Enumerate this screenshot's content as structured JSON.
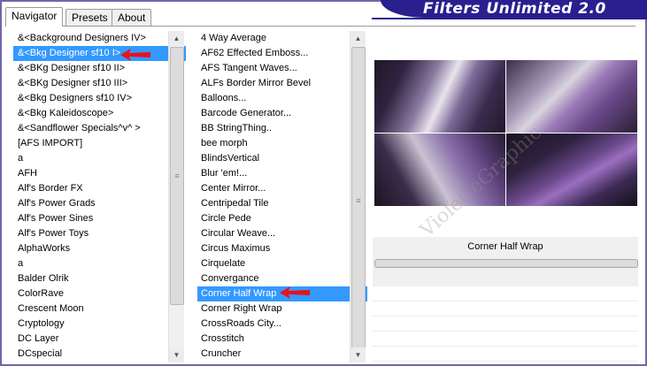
{
  "window": {
    "banner_title": "Filters Unlimited 2.0",
    "accent_color": "#2a1f8f",
    "frame_color": "#7565a8"
  },
  "tabs": [
    {
      "label": "Navigator",
      "active": true
    },
    {
      "label": "Presets",
      "active": false
    },
    {
      "label": "About",
      "active": false
    }
  ],
  "categories": {
    "items": [
      "&<Background Designers IV>",
      "&<Bkg Designer sf10 I>",
      "&<BKg Designer sf10 II>",
      "&<BKg Designer sf10 III>",
      "&<Bkg Designers sf10 IV>",
      "&<Bkg Kaleidoscope>",
      "&<Sandflower Specials^v^ >",
      "[AFS IMPORT]",
      "a",
      "AFH",
      "Alf's Border FX",
      "Alf's Power Grads",
      "Alf's Power Sines",
      "Alf's Power Toys",
      "AlphaWorks",
      "a",
      "Balder Olrik",
      "ColorRave",
      "Crescent Moon",
      "Cryptology",
      "DC Layer",
      "DCspecial"
    ],
    "selected_index": 1
  },
  "filters": {
    "items": [
      "4 Way Average",
      "AF62 Effected Emboss...",
      "AFS Tangent Waves...",
      "ALFs Border Mirror Bevel",
      "Balloons...",
      "Barcode Generator...",
      "BB StringThing..",
      "bee morph",
      "BlindsVertical",
      "Blur 'em!...",
      "Center Mirror...",
      "Centripedal Tile",
      "Circle Pede",
      "Circular Weave...",
      "Circus Maximus",
      "Cirquelate",
      "Convergance",
      "Corner Half Wrap",
      "Corner Right Wrap",
      "CrossRoads City...",
      "Crosstitch",
      "Cruncher"
    ],
    "selected_index": 17
  },
  "preview": {
    "filter_name": "Corner Half Wrap",
    "watermark": "VioletteGraphic"
  },
  "icons": {
    "scroll_up": "up-arrow-icon",
    "scroll_down": "down-arrow-icon",
    "scroll_grip": "grip-icon",
    "pointer_arrow": "red-arrow-icon"
  }
}
